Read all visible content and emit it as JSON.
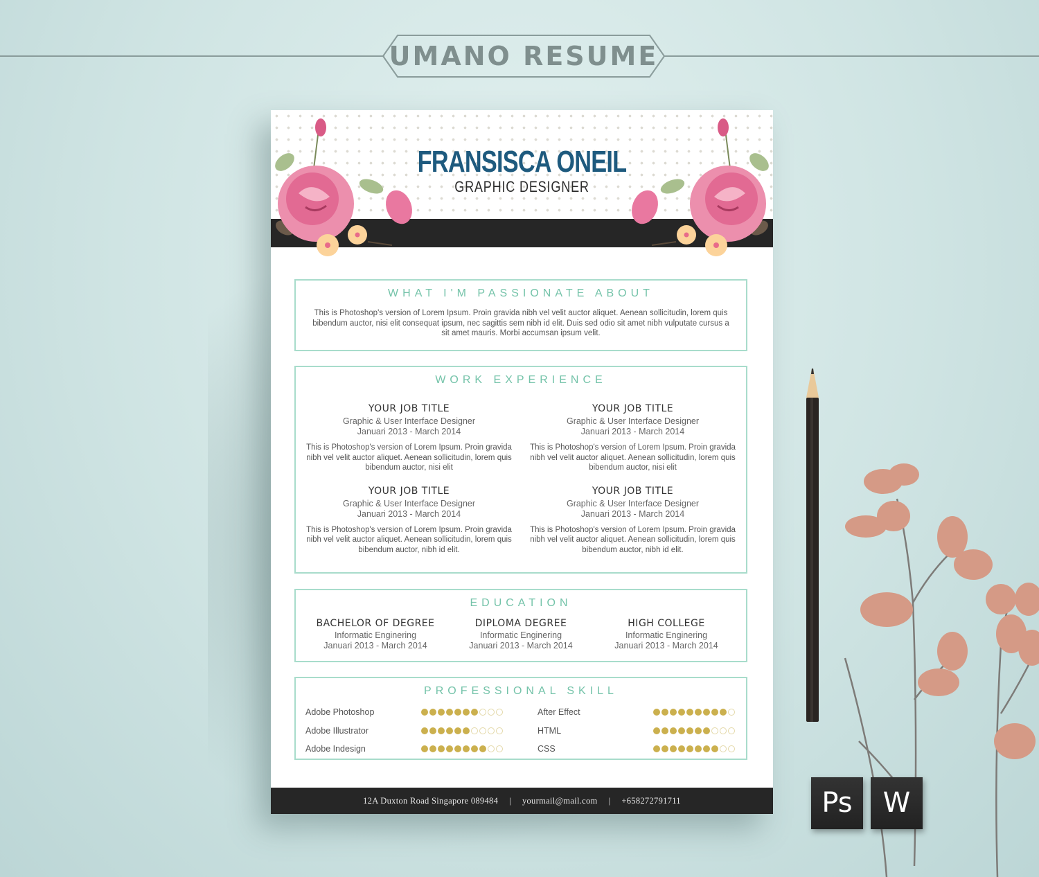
{
  "banner": {
    "title": "UMANO  RESUME"
  },
  "resume": {
    "name": "FRANSISCA ONEIL",
    "role": "GRAPHIC  DESIGNER",
    "passion": {
      "title": "WHAT I'M PASSIONATE ABOUT",
      "text": "This is Photoshop's version  of Lorem Ipsum. Proin gravida nibh vel velit auctor aliquet. Aenean sollicitudin, lorem quis bibendum auctor, nisi elit consequat ipsum, nec sagittis sem nibh id elit. Duis sed odio sit amet nibh vulputate cursus a sit amet mauris. Morbi accumsan ipsum velit."
    },
    "work": {
      "title": "WORK EXPERIENCE",
      "jobs": [
        {
          "title": "YOUR JOB TITLE",
          "position": "Graphic & User Interface Designer",
          "dates": "Januari 2013 - March 2014",
          "desc": "This is Photoshop's version  of Lorem Ipsum. Proin gravida nibh vel velit auctor aliquet. Aenean sollicitudin, lorem quis bibendum auctor, nisi elit"
        },
        {
          "title": "YOUR JOB TITLE",
          "position": "Graphic & User Interface Designer",
          "dates": "Januari 2013 - March 2014",
          "desc": "This is Photoshop's version  of Lorem Ipsum. Proin gravida nibh vel velit auctor aliquet. Aenean sollicitudin, lorem quis bibendum auctor, nisi elit"
        },
        {
          "title": "YOUR JOB TITLE",
          "position": "Graphic & User Interface Designer",
          "dates": "Januari 2013 - March 2014",
          "desc": "This is Photoshop's version  of Lorem Ipsum. Proin gravida nibh vel velit auctor aliquet. Aenean sollicitudin, lorem quis bibendum auctor, nibh id elit."
        },
        {
          "title": "YOUR JOB TITLE",
          "position": "Graphic & User Interface Designer",
          "dates": "Januari 2013 - March 2014",
          "desc": "This is Photoshop's version  of Lorem Ipsum. Proin gravida nibh vel velit auctor aliquet. Aenean sollicitudin, lorem quis bibendum auctor, nibh id elit."
        }
      ]
    },
    "education": {
      "title": "EDUCATION",
      "items": [
        {
          "degree": "BACHELOR OF DEGREE",
          "field": "Informatic Enginering",
          "dates": "Januari 2013 - March 2014"
        },
        {
          "degree": "DIPLOMA DEGREE",
          "field": "Informatic Enginering",
          "dates": "Januari 2013 - March 2014"
        },
        {
          "degree": "HIGH COLLEGE",
          "field": "Informatic Enginering",
          "dates": "Januari 2013 - March 2014"
        }
      ]
    },
    "skills": {
      "title": "PROFESSIONAL SKILL",
      "max": 10,
      "items": [
        {
          "name": "Adobe Photoshop",
          "level": 7
        },
        {
          "name": "After Effect",
          "level": 9
        },
        {
          "name": "Adobe Illustrator",
          "level": 6
        },
        {
          "name": "HTML",
          "level": 7
        },
        {
          "name": "Adobe Indesign",
          "level": 8
        },
        {
          "name": "CSS",
          "level": 8
        }
      ]
    },
    "footer": {
      "address": "12A Duxton Road Singapore 089484",
      "email": "yourmail@mail.com",
      "phone": "+658272791711",
      "separator": "|"
    }
  },
  "badges": {
    "photoshop": "Ps",
    "word": "W"
  },
  "colors": {
    "accent": "#74c3a9",
    "name": "#1e5a7e",
    "skill_dot": "#cbb04e",
    "band": "#262626"
  }
}
